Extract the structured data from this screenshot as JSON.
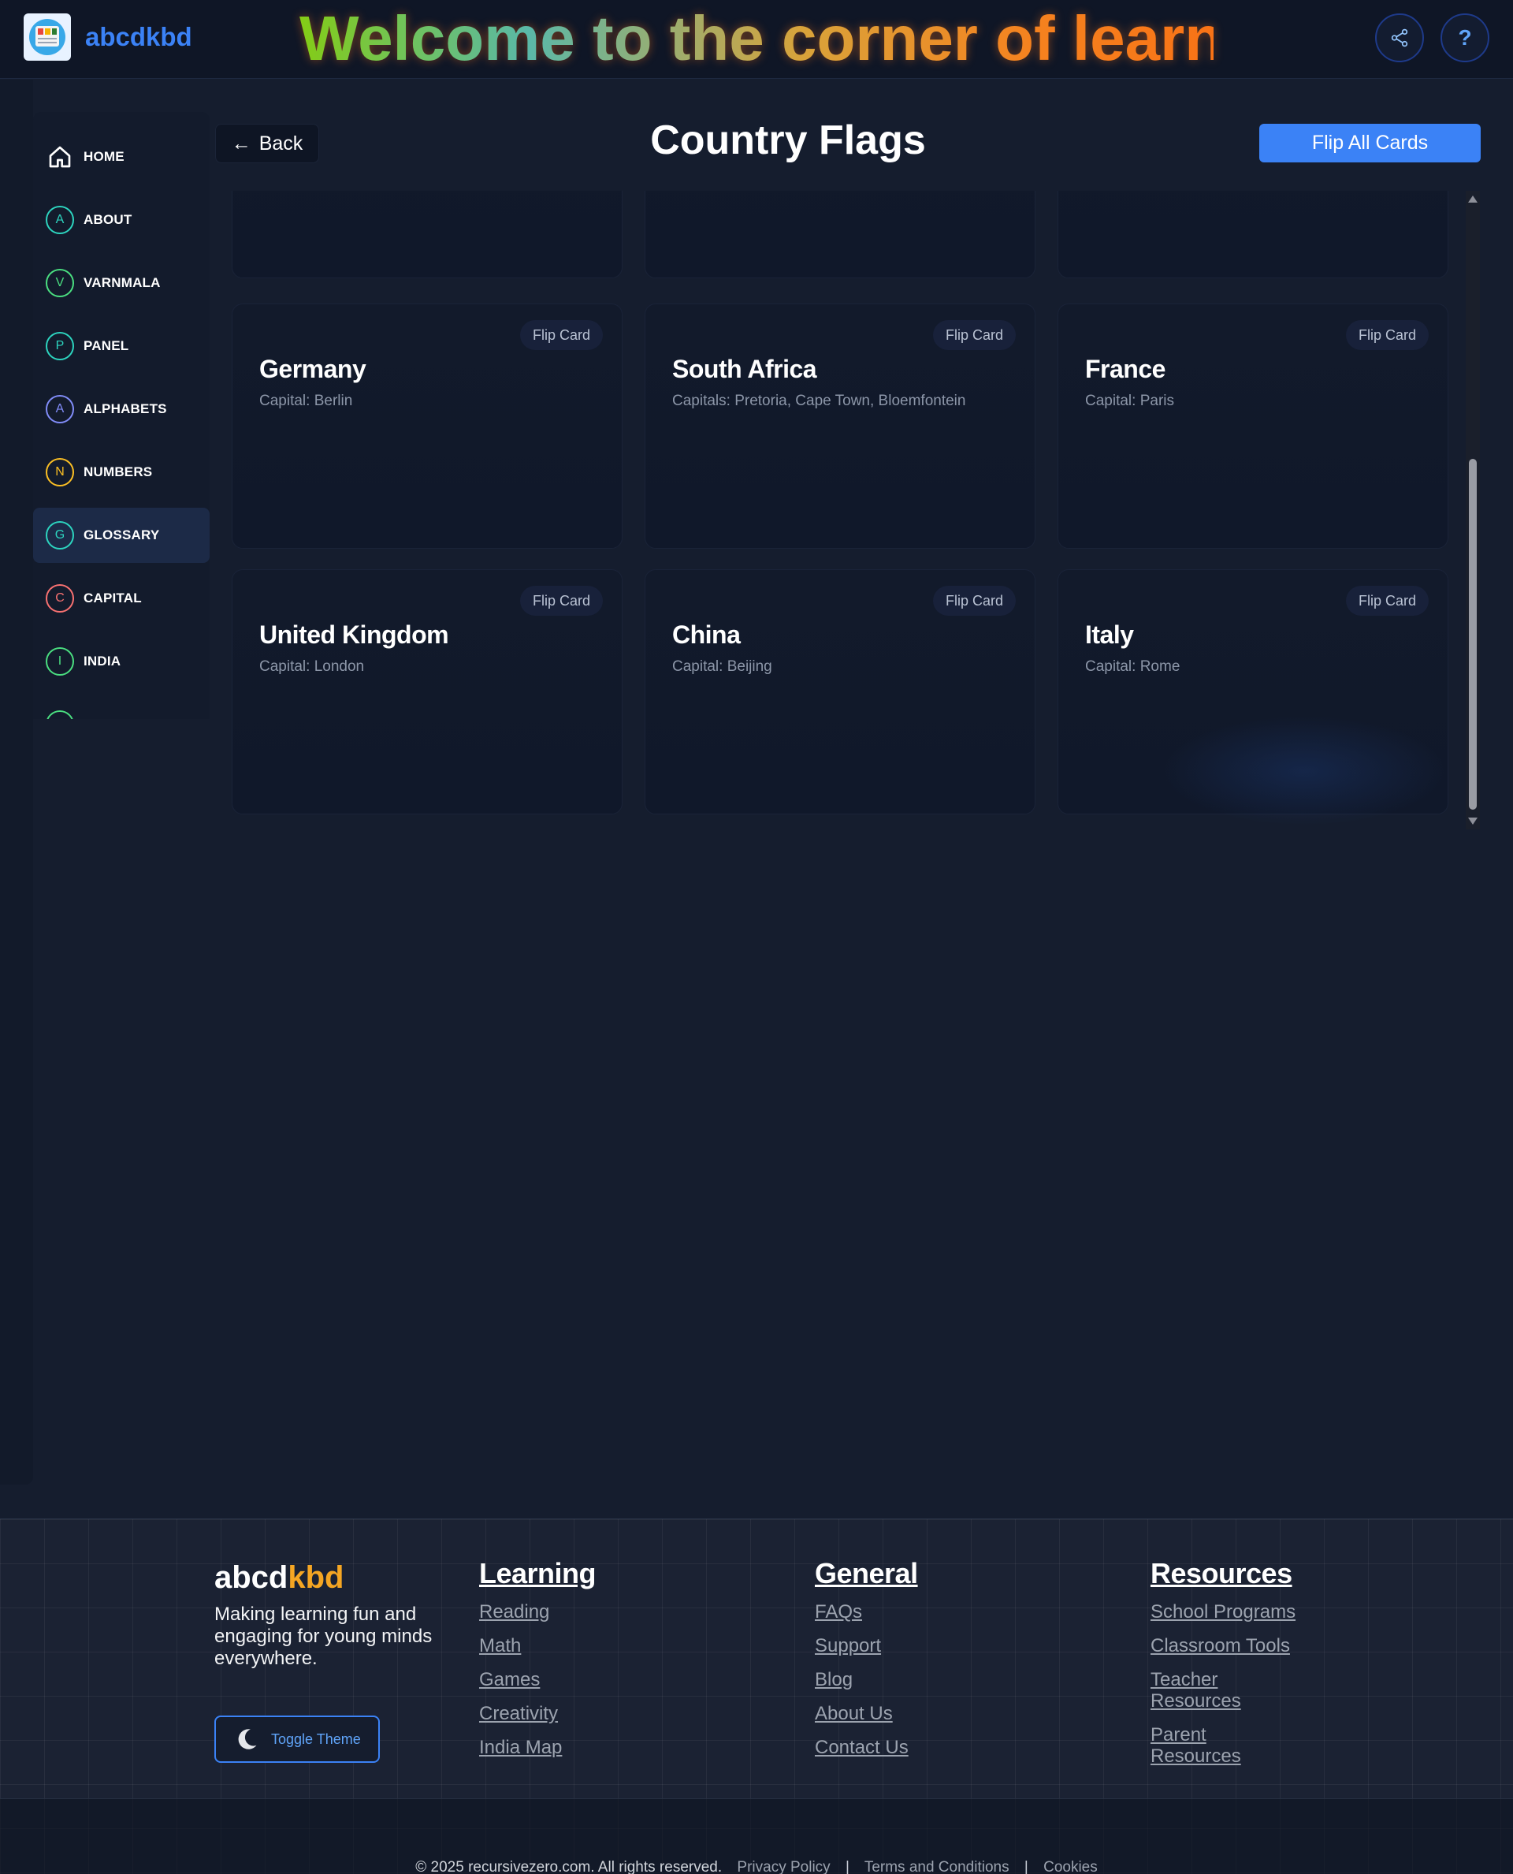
{
  "header": {
    "brand": "abcdkbd",
    "welcome": "Welcome to the corner of learning",
    "help_label": "?"
  },
  "sidebar": {
    "items": [
      {
        "label": "HOME",
        "icon": "home-icon",
        "color": "#ffffff"
      },
      {
        "label": "ABOUT",
        "letter": "A",
        "color": "#2dd4bf"
      },
      {
        "label": "VARNMALA",
        "letter": "V",
        "color": "#4ade80"
      },
      {
        "label": "PANEL",
        "letter": "P",
        "color": "#2dd4bf"
      },
      {
        "label": "ALPHABETS",
        "letter": "A",
        "color": "#818cf8"
      },
      {
        "label": "NUMBERS",
        "letter": "N",
        "color": "#fbbf24"
      },
      {
        "label": "GLOSSARY",
        "letter": "G",
        "color": "#2dd4bf",
        "active": true
      },
      {
        "label": "CAPITAL",
        "letter": "C",
        "color": "#f87171"
      },
      {
        "label": "INDIA",
        "letter": "I",
        "color": "#4ade80"
      }
    ]
  },
  "content": {
    "back_label": "Back",
    "back_arrow": "←",
    "title": "Country Flags",
    "flip_all_label": "Flip All Cards"
  },
  "cards": [
    {
      "name": "Germany",
      "capital": "Capital: Berlin",
      "flip_label": "Flip Card"
    },
    {
      "name": "South Africa",
      "capital": "Capitals: Pretoria, Cape Town, Bloemfontein",
      "flip_label": "Flip Card"
    },
    {
      "name": "France",
      "capital": "Capital: Paris",
      "flip_label": "Flip Card"
    },
    {
      "name": "United Kingdom",
      "capital": "Capital: London",
      "flip_label": "Flip Card"
    },
    {
      "name": "China",
      "capital": "Capital: Beijing",
      "flip_label": "Flip Card"
    },
    {
      "name": "Italy",
      "capital": "Capital: Rome",
      "flip_label": "Flip Card"
    }
  ],
  "footer": {
    "brand_main": "abcd",
    "brand_accent": "kbd",
    "tagline": "Making learning fun and engaging for young minds everywhere.",
    "toggle_label": "Toggle Theme",
    "learning": {
      "title": "Learning",
      "links": [
        "Reading",
        "Math",
        "Games",
        "Creativity",
        "India Map"
      ]
    },
    "general": {
      "title": "General",
      "links": [
        "FAQs",
        "Support",
        "Blog",
        "About Us",
        "Contact Us"
      ]
    },
    "resources": {
      "title": "Resources",
      "links": [
        "School Programs",
        "Classroom Tools",
        "Teacher Resources",
        "Parent Resources"
      ]
    },
    "copyright": "© 2025 recursivezero.com. All rights reserved.",
    "legal": [
      "Privacy Policy",
      "Terms and Conditions",
      "Cookies"
    ],
    "legal_sep": "|"
  },
  "colors": {
    "accent": "#3b82f6",
    "brand_accent": "#f5a623",
    "background": "#151d2e"
  }
}
